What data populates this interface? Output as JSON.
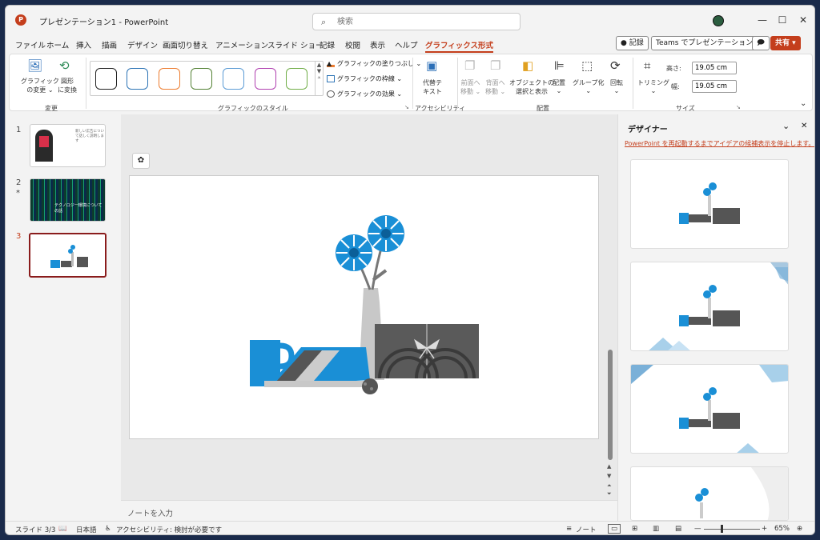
{
  "titlebar": {
    "app_logo": "P",
    "doc_title": "プレゼンテーション1 - PowerPoint",
    "search_placeholder": "検索",
    "minimize": "—",
    "maximize": "☐",
    "close": "✕"
  },
  "menu": {
    "items": [
      "ファイル",
      "ホーム",
      "挿入",
      "描画",
      "デザイン",
      "画面切り替え",
      "アニメーション",
      "スライド ショー",
      "記録",
      "校閲",
      "表示",
      "ヘルプ",
      "グラフィックス形式"
    ],
    "active": "グラフィックス形式",
    "record_btn": "● 記録",
    "teams_btn": "Teams でプレゼンテーション",
    "comment_btn": "🗩",
    "share_btn": "共有 ▾"
  },
  "ribbon": {
    "change_graphic": [
      "グラフィック",
      "の変更 ⌄"
    ],
    "convert_shape": [
      "図形",
      "に変換"
    ],
    "group_change": "変更",
    "swatch_colors": [
      "#222222",
      "#2e75b6",
      "#ed7d31",
      "#548235",
      "#5b9bd5",
      "#b040b0",
      "#70ad47"
    ],
    "fill_label": "グラフィックの塗りつぶし ⌄",
    "outline_label": "グラフィックの枠線 ⌄",
    "effect_label": "グラフィックの効果 ⌄",
    "group_styles": "グラフィックのスタイル",
    "alt_text": [
      "代替テ",
      "キスト"
    ],
    "group_accessibility": "アクセシビリティ",
    "bring_forward": [
      "前面へ",
      "移動 ⌄"
    ],
    "send_backward": [
      "背面へ",
      "移動 ⌄"
    ],
    "selection_pane": [
      "オブジェクトの",
      "選択と表示"
    ],
    "align": [
      "配置",
      "⌄"
    ],
    "group_btn": [
      "グループ化",
      "⌄"
    ],
    "rotate": [
      "回転",
      "⌄"
    ],
    "group_arrange": "配置",
    "crop": [
      "トリミング",
      "⌄"
    ],
    "height_label": "高さ:",
    "height_value": "19.05 cm",
    "width_label": "幅:",
    "width_value": "19.05 cm",
    "group_size": "サイズ",
    "collapse": "⌄"
  },
  "slides": [
    {
      "number": "1",
      "text": "新しい広告について話しく説明します"
    },
    {
      "number": "2",
      "marker": "*",
      "text": "テクノロジー環境についての話"
    },
    {
      "number": "3"
    }
  ],
  "editor": {
    "designer_icon": "✿",
    "notes_placeholder": "ノートを入力"
  },
  "designer": {
    "title": "デザイナー",
    "chevron": "⌄",
    "close": "✕",
    "restart_link": "PowerPoint を再起動するまでアイデアの候補表示を停止します。"
  },
  "status": {
    "slide_counter": "スライド 3/3",
    "language": "日本語",
    "accessibility": "アクセシビリティ: 検討が必要です",
    "notes_btn": "ノート",
    "zoom_minus": "—",
    "zoom_plus": "+",
    "zoom_level": "65%"
  },
  "colors": {
    "accent": "#c43e1c",
    "flower_blue": "#1a8fd6",
    "gift_gray": "#5a5a5a"
  }
}
